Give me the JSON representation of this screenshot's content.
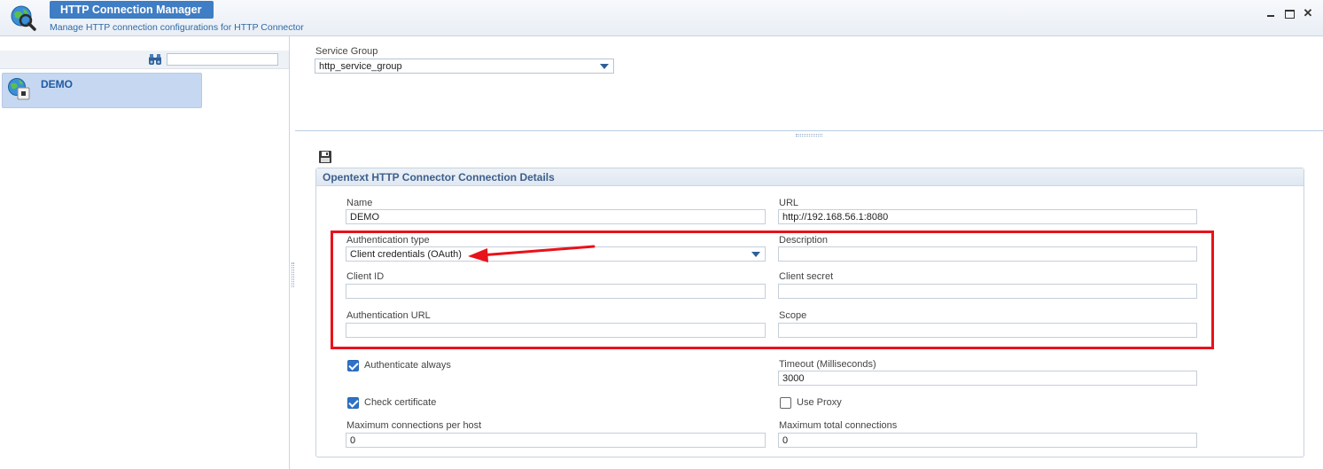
{
  "app": {
    "title": "HTTP Connection Manager",
    "subtitle": "Manage HTTP connection configurations for HTTP Connector",
    "icon": "globe-search-icon"
  },
  "window_controls": {
    "minimize": "minimize-icon",
    "maximize": "maximize-icon",
    "close": "✕"
  },
  "left_panel": {
    "search": {
      "value": "",
      "placeholder": ""
    },
    "items": [
      {
        "label": "DEMO",
        "icon": "http-connection-icon",
        "selected": true
      }
    ]
  },
  "service_group": {
    "label": "Service Group",
    "value": "http_service_group"
  },
  "details": {
    "title": "Opentext HTTP Connector Connection Details",
    "fields": {
      "name": {
        "label": "Name",
        "value": "DEMO"
      },
      "url": {
        "label": "URL",
        "value": "http://192.168.56.1:8080"
      },
      "auth_type": {
        "label": "Authentication type",
        "value": "Client credentials (OAuth)"
      },
      "description": {
        "label": "Description",
        "value": ""
      },
      "client_id": {
        "label": "Client ID",
        "value": ""
      },
      "client_secret": {
        "label": "Client secret",
        "value": ""
      },
      "auth_url": {
        "label": "Authentication URL",
        "value": ""
      },
      "scope": {
        "label": "Scope",
        "value": ""
      },
      "authenticate_always": {
        "label": "Authenticate always",
        "checked": true
      },
      "timeout": {
        "label": "Timeout (Milliseconds)",
        "value": "3000"
      },
      "check_certificate": {
        "label": "Check certificate",
        "checked": true
      },
      "use_proxy": {
        "label": "Use Proxy",
        "checked": false
      },
      "max_per_host": {
        "label": "Maximum connections per host",
        "value": "0"
      },
      "max_total": {
        "label": "Maximum total connections",
        "value": "0"
      }
    }
  },
  "annotation": {
    "box_color": "#e8121a",
    "arrow_color": "#e8121a"
  },
  "colors": {
    "accent": "#3f7dc4",
    "selection": "#c6d8f1",
    "checkbox": "#2e72c8"
  }
}
